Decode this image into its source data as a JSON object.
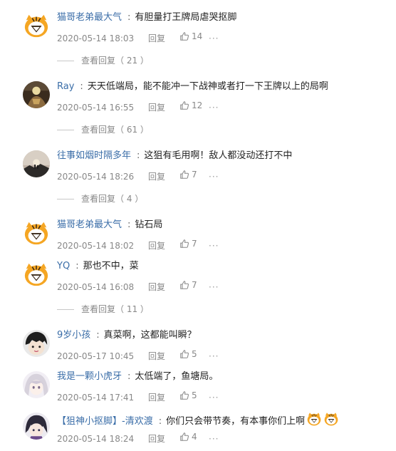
{
  "comments": [
    {
      "user": "猫哥老弟最大气",
      "avatar": "tiger-mascot",
      "text": "有胆量打王牌局虐哭抠脚",
      "time": "2020-05-14 18:03",
      "reply_label": "回复",
      "likes": "14",
      "more": "···",
      "view_replies": "查看回复（ 21 ）"
    },
    {
      "user": "Ray",
      "avatar": "dark-photo",
      "text": "天天低端局，能不能冲一下战神或者打一下王牌以上的局啊",
      "time": "2020-05-14 16:55",
      "reply_label": "回复",
      "likes": "12",
      "more": "···",
      "view_replies": "查看回复（ 61 ）"
    },
    {
      "user": "往事如烟时隔多年",
      "avatar": "sunset-photo",
      "text": "这狙有毛用啊！敌人都没动还打不中",
      "time": "2020-05-14 18:26",
      "reply_label": "回复",
      "likes": "7",
      "more": "···",
      "view_replies": "查看回复（ 4 ）"
    },
    {
      "user": "猫哥老弟最大气",
      "avatar": "tiger-mascot",
      "text": "钻石局",
      "time": "2020-05-14 18:02",
      "reply_label": "回复",
      "likes": "7",
      "more": "···"
    },
    {
      "user": "YQ",
      "avatar": "tiger-mascot",
      "text": "那也不中，菜",
      "time": "2020-05-14 16:08",
      "reply_label": "回复",
      "likes": "7",
      "more": "···",
      "view_replies": "查看回复（ 11 ）"
    },
    {
      "user": "9岁小孩",
      "avatar": "anime-boy",
      "text": "真菜啊，这都能叫瞬？",
      "time": "2020-05-17 10:45",
      "reply_label": "回复",
      "likes": "5",
      "more": "···"
    },
    {
      "user": "我是一颗小虎牙",
      "avatar": "anime-girl",
      "text": "太低端了，鱼塘局。",
      "time": "2020-05-14 17:41",
      "reply_label": "回复",
      "likes": "5",
      "more": "···"
    },
    {
      "user": "【狙神小抠脚】-清欢渡",
      "avatar": "anime-boy-2",
      "text": "你们只会带节奏，有本事你们上啊",
      "time": "2020-05-14 18:24",
      "reply_label": "回复",
      "likes": "4",
      "more": "···",
      "emojis": [
        "tiger-emoji",
        "tiger-emoji"
      ]
    }
  ],
  "colors": {
    "username": "#3b6ea8",
    "meta": "#888888",
    "mascot_orange": "#f5a623"
  }
}
